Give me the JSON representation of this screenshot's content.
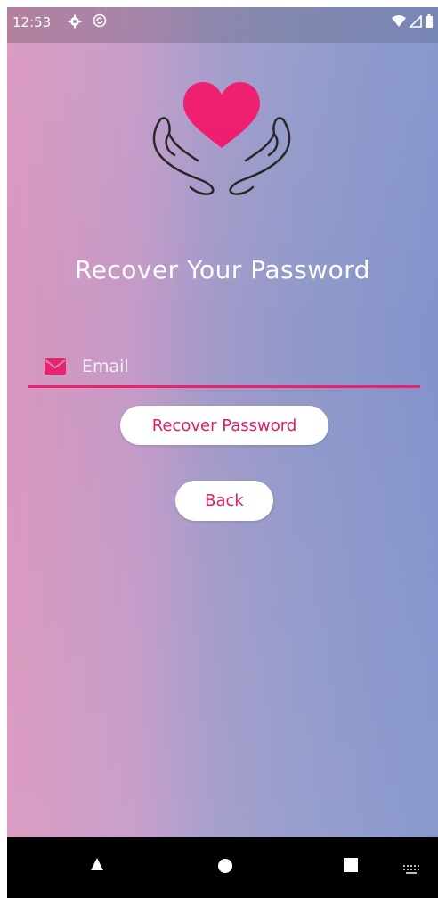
{
  "status_bar": {
    "time": "12:53",
    "settings_icon": "gear-icon",
    "sync_icon": "sync-icon",
    "wifi_icon": "wifi-icon",
    "signal_icon": "signal-icon",
    "battery_icon": "battery-icon"
  },
  "logo": {
    "icon": "heart-in-hands-icon",
    "heart_color": "#f0176b"
  },
  "title": "Recover Your Password",
  "email": {
    "placeholder": "Email",
    "value": "",
    "icon": "mail-icon",
    "accent": "#e7246b"
  },
  "buttons": {
    "recover": "Recover Password",
    "back": "Back"
  },
  "nav_bar": {
    "back_icon": "nav-back-icon",
    "home_icon": "nav-home-icon",
    "recents_icon": "nav-recents-icon",
    "keyboard_icon": "keyboard-icon"
  },
  "colors": {
    "accent": "#e01a63",
    "button_bg": "#ffffff",
    "gradient_left": "#d997bd",
    "gradient_right": "#8393cb"
  }
}
